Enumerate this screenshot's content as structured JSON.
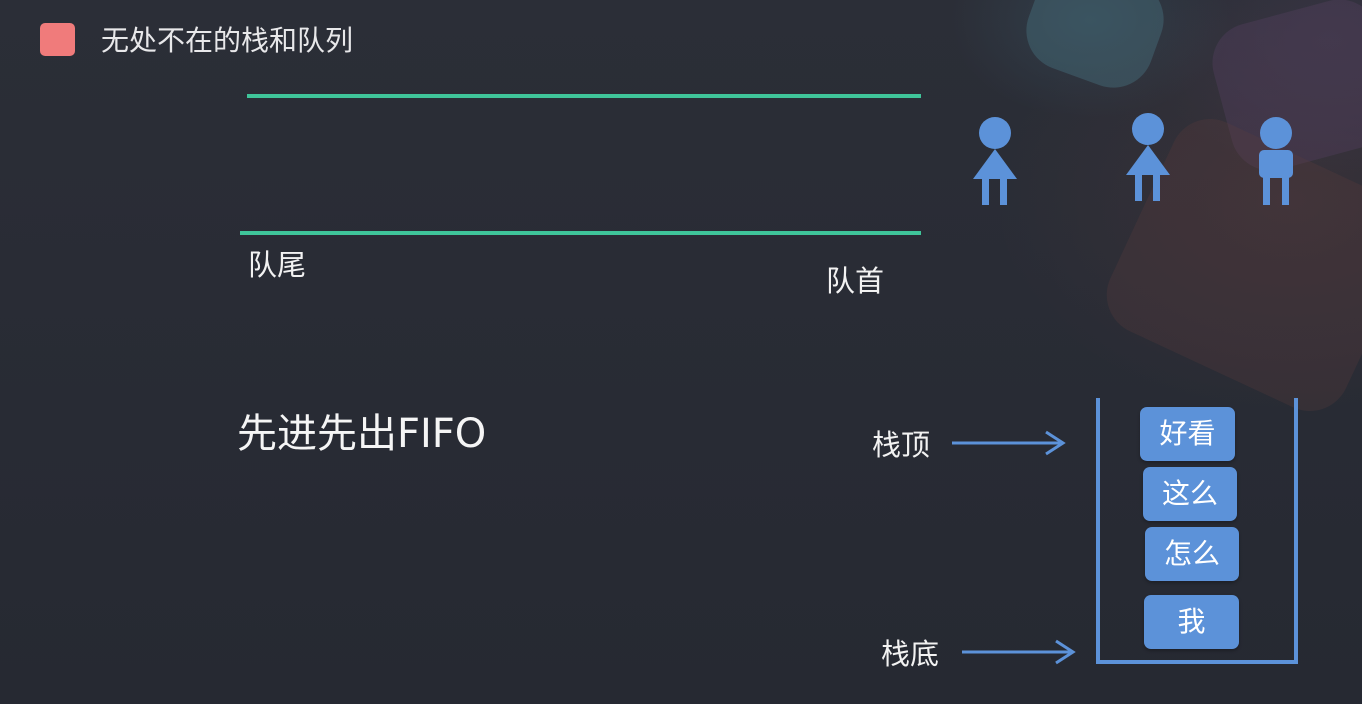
{
  "header": {
    "title": "无处不在的栈和队列",
    "accent_color": "#f07b7b"
  },
  "queue": {
    "tail_label": "队尾",
    "head_label": "队首",
    "line_color": "#3fc59a",
    "people": [
      {
        "icon": "person-female-icon"
      },
      {
        "icon": "person-female-icon"
      },
      {
        "icon": "person-male-icon"
      }
    ]
  },
  "fifo_text": "先进先出FIFO",
  "stack": {
    "top_label": "栈顶",
    "bottom_label": "栈底",
    "items": [
      "好看",
      "这么",
      "怎么",
      "我"
    ],
    "item_color": "#5c92d9",
    "border_color": "#5c92d9"
  }
}
